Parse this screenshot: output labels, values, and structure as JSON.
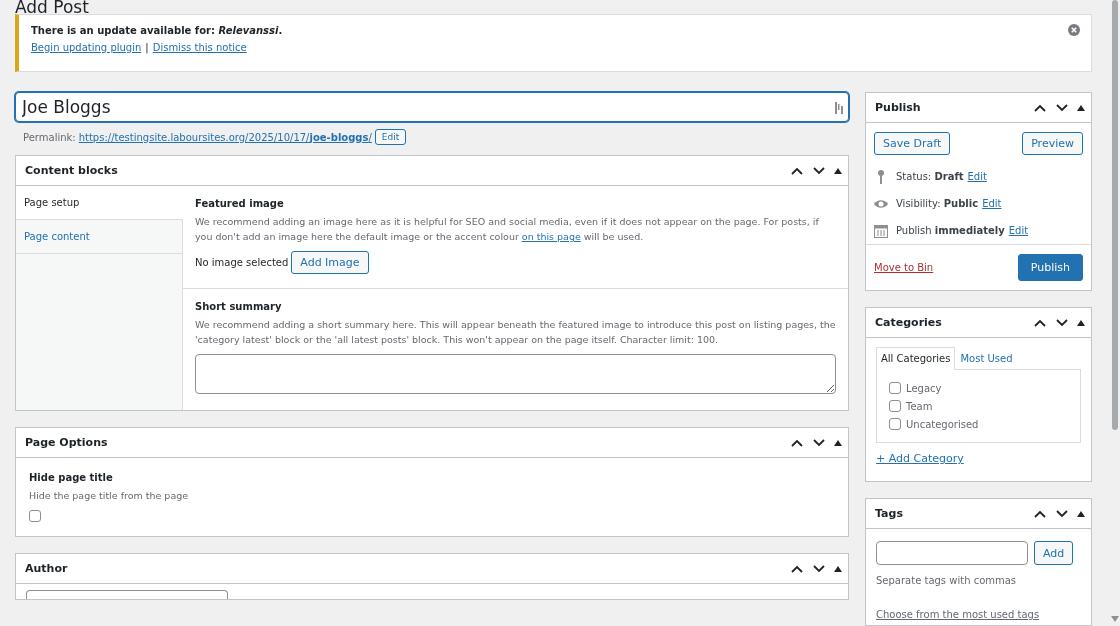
{
  "page_title": "Add Post",
  "notice": {
    "text": "There is an update available for: *Relevanssi*.",
    "links": [
      "Begin updating plugin",
      "Dismiss this notice"
    ],
    "separator": "|"
  },
  "post_title": {
    "value": "Joe Bloggs"
  },
  "permalink": {
    "label": "Permalink:",
    "url": "https://testingsite.laboursites.org/2025/10/17/**joe-bloggs**/",
    "button": "Edit"
  },
  "content_blocks": {
    "title": "Content blocks",
    "tabs": [
      {
        "label": "Page setup",
        "selected": true
      },
      {
        "label": "Page content",
        "selected": false
      }
    ],
    "featured_image": {
      "title": "Featured image",
      "description_before": "We recommend adding an image here as it is helpful for SEO and social media, even if it does not appear on the page. For posts, if you don't add an image here the default image or the accent colour",
      "link": "on this page",
      "description_after": "will be used.",
      "status": "No image selected",
      "button": "Add Image"
    },
    "short_summary": {
      "title": "Short summary",
      "description": "We recommend adding a short summary here. This will appear beneath the featured image to introduce this post on listing pages, the 'category latest' block or the 'all latest posts' block. This won't appear on the page itself. Character limit: 100."
    }
  },
  "page_options": {
    "title": "Page Options",
    "field_title": "Hide page title",
    "description": "Hide the page title from the page",
    "checked": false
  },
  "author": {
    "title": "Author"
  },
  "publish": {
    "title": "Publish",
    "save_draft": "Save Draft",
    "preview": "Preview",
    "rows": [
      {
        "kind": "status",
        "text": "Status: **Draft**",
        "link": "Edit"
      },
      {
        "kind": "visibility",
        "text": "Visibility: **Public**",
        "link": "Edit"
      },
      {
        "kind": "schedule",
        "text": "Publish **immediately**",
        "link": "Edit"
      }
    ],
    "move_to_bin": "Move to Bin",
    "publish_button": "Publish"
  },
  "categories": {
    "title": "Categories",
    "tabs": [
      {
        "label": "All Categories",
        "selected": true
      },
      {
        "label": "Most Used",
        "selected": false
      }
    ],
    "items": [
      {
        "label": "Legacy",
        "checked": false
      },
      {
        "label": "Team",
        "checked": false
      },
      {
        "label": "Uncategorised",
        "checked": false
      }
    ],
    "add_link": "+ Add Category"
  },
  "tags": {
    "title": "Tags",
    "button": "Add",
    "hint": "Separate tags with commas",
    "link": "Choose from the most used tags"
  }
}
